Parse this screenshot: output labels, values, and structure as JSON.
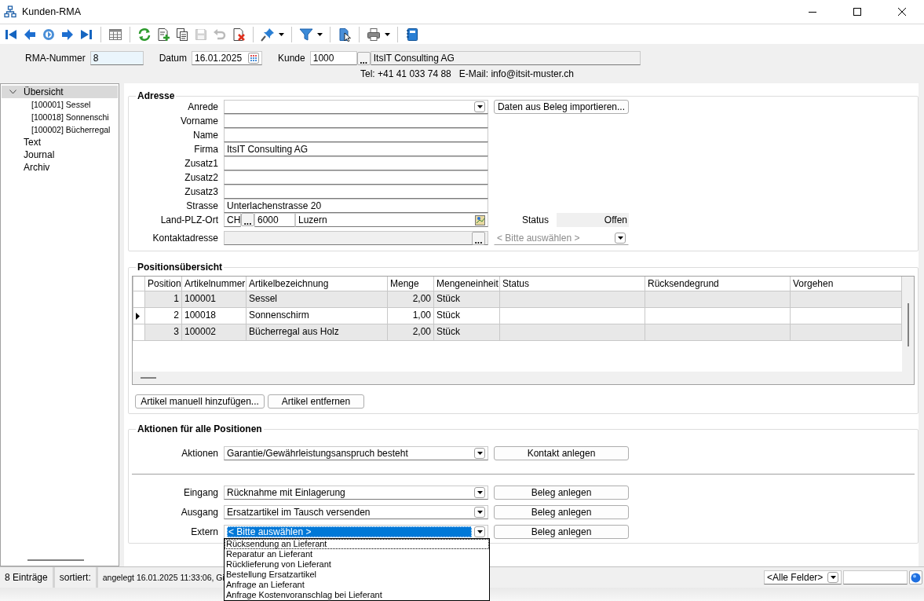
{
  "window": {
    "title": "Kunden-RMA"
  },
  "toolbar": [
    {
      "kind": "first",
      "disabled": false,
      "menu": false
    },
    {
      "kind": "prev",
      "disabled": false,
      "menu": false
    },
    {
      "kind": "goto",
      "disabled": false,
      "menu": false
    },
    {
      "kind": "next",
      "disabled": false,
      "menu": false
    },
    {
      "kind": "last",
      "disabled": false,
      "menu": false
    },
    {
      "kind": "sep"
    },
    {
      "kind": "grid",
      "disabled": false,
      "menu": false
    },
    {
      "kind": "sep"
    },
    {
      "kind": "refresh",
      "disabled": false,
      "menu": false
    },
    {
      "kind": "new",
      "disabled": false,
      "menu": false
    },
    {
      "kind": "copy",
      "disabled": false,
      "menu": false
    },
    {
      "kind": "save",
      "disabled": true,
      "menu": false
    },
    {
      "kind": "undo",
      "disabled": true,
      "menu": false
    },
    {
      "kind": "delete",
      "disabled": false,
      "menu": false
    },
    {
      "kind": "sep"
    },
    {
      "kind": "pin",
      "disabled": false,
      "menu": true
    },
    {
      "kind": "sep"
    },
    {
      "kind": "filter",
      "disabled": false,
      "menu": true
    },
    {
      "kind": "sep"
    },
    {
      "kind": "layout",
      "disabled": false,
      "menu": false
    },
    {
      "kind": "sep"
    },
    {
      "kind": "print",
      "disabled": false,
      "menu": true
    },
    {
      "kind": "sep"
    },
    {
      "kind": "book",
      "disabled": false,
      "menu": false
    }
  ],
  "header": {
    "rma_label": "RMA-Nummer",
    "rma_value": "8",
    "date_label": "Datum",
    "date_value": "16.01.2025",
    "customer_label": "Kunde",
    "customer_value": "1000",
    "customer_button": "...",
    "customer_name": "ItsIT Consulting AG",
    "contact_line": "Tel: +41 41 033 74 88   E-Mail: info@itsit-muster.ch"
  },
  "sidebar": {
    "items": [
      {
        "label": "Übersicht",
        "selected": true,
        "expanded": true,
        "children": [
          {
            "label": "[100001] Sessel",
            "selected": false
          },
          {
            "label": "[100018] Sonnenschi",
            "selected": false
          },
          {
            "label": "[100002] Bücherregal",
            "selected": false
          }
        ]
      },
      {
        "label": "Text",
        "selected": false
      },
      {
        "label": "Journal",
        "selected": false
      },
      {
        "label": "Archiv",
        "selected": false
      }
    ]
  },
  "address": {
    "title": "Adresse",
    "fields": [
      {
        "kind": "combo",
        "label": "Anrede",
        "disabled": false
      },
      {
        "kind": "text",
        "label": "Vorname",
        "disabled": false
      },
      {
        "kind": "text",
        "label": "Name",
        "disabled": false
      },
      {
        "kind": "text",
        "label": "Firma",
        "value": "ItsIT Consulting AG",
        "disabled": false
      },
      {
        "kind": "text",
        "label": "Zusatz1",
        "disabled": false
      },
      {
        "kind": "text",
        "label": "Zusatz2",
        "disabled": false
      },
      {
        "kind": "text",
        "label": "Zusatz3",
        "disabled": false
      },
      {
        "kind": "text",
        "label": "Strasse",
        "value": "Unterlachenstrasse 20",
        "disabled": false
      },
      {
        "kind": "location",
        "label": "Land-PLZ-Ort",
        "country": "CH",
        "button": "...",
        "zip": "6000",
        "city": "Luzern",
        "disabled": false
      },
      {
        "kind": "lookup",
        "label": "Kontaktadresse",
        "button": "...",
        "disabled": true
      }
    ],
    "import_button": "Daten aus Beleg importieren...",
    "status_label": "Status",
    "status_value": "Offen",
    "contact_combo": {
      "placeholder": "< Bitte auswählen >"
    }
  },
  "positions": {
    "title": "Positionsübersicht",
    "columns": [
      "Position",
      "Artikelnummer",
      "Artikelbezeichnung",
      "Menge",
      "Mengeneinheit",
      "Status",
      "Rücksendegrund",
      "Vorgehen"
    ],
    "rows": [
      {
        "selected": false,
        "cells": [
          "1",
          "100001",
          "Sessel",
          "2,00",
          "Stück"
        ]
      },
      {
        "selected": true,
        "cells": [
          "2",
          "100018",
          "Sonnenschirm",
          "1,00",
          "Stück"
        ]
      },
      {
        "selected": false,
        "cells": [
          "3",
          "100002",
          "Bücherregal aus Holz",
          "2,00",
          "Stück"
        ]
      }
    ],
    "buttons": [
      "Artikel manuell hinzufügen...",
      "Artikel entfernen"
    ]
  },
  "actions": {
    "title": "Aktionen für alle Positionen",
    "sections": [
      {
        "rows": [
          {
            "label": "Aktionen",
            "value": "Garantie/Gewährleistungsanspruch besteht",
            "button": "Kontakt anlegen",
            "open": false
          }
        ]
      },
      {
        "rows": [
          {
            "label": "Eingang",
            "value": "Rücknahme mit Einlagerung",
            "button": "Beleg anlegen",
            "open": false
          },
          {
            "label": "Ausgang",
            "value": "Ersatzartikel im Tausch versenden",
            "button": "Beleg anlegen",
            "open": false
          },
          {
            "label": "Extern",
            "value": "< Bitte auswählen >",
            "button": "Beleg anlegen",
            "open": true,
            "options": [
              {
                "label": "Rücksendung an Lieferant",
                "selected": true
              },
              {
                "label": "Reparatur an Lieferant",
                "selected": false
              },
              {
                "label": "Rücklieferung von Lieferant",
                "selected": false
              },
              {
                "label": "Bestellung Ersatzartikel",
                "selected": false
              },
              {
                "label": "Anfrage an Lieferant",
                "selected": false
              },
              {
                "label": "Anfrage Kostenvoranschlag bei Lieferant",
                "selected": false
              }
            ]
          }
        ]
      }
    ]
  },
  "status_bar": {
    "count": "8 Einträge",
    "sort": "sortiert:",
    "info": "angelegt 16.01.2025 11:33:06, Gi",
    "field_filter": "<Alle Felder>"
  }
}
